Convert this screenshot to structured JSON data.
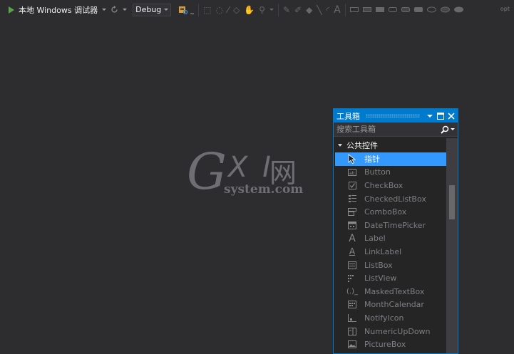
{
  "toolbar": {
    "run_label": "本地 Windows 调试器",
    "config_value": "Debug",
    "overflow_label": "opt"
  },
  "watermark": {
    "letter_g": "G",
    "letters_xi": "X I",
    "char_wang": "网",
    "subtitle": "system.com"
  },
  "toolbox": {
    "title": "工具箱",
    "search_placeholder": "搜索工具箱",
    "group_label": "公共控件",
    "items": [
      {
        "label": "指针",
        "icon": "pointer-icon",
        "selected": true
      },
      {
        "label": "Button",
        "icon": "button-icon"
      },
      {
        "label": "CheckBox",
        "icon": "checkbox-icon"
      },
      {
        "label": "CheckedListBox",
        "icon": "checkedlistbox-icon"
      },
      {
        "label": "ComboBox",
        "icon": "combobox-icon"
      },
      {
        "label": "DateTimePicker",
        "icon": "datetimepicker-icon"
      },
      {
        "label": "Label",
        "icon": "label-icon"
      },
      {
        "label": "LinkLabel",
        "icon": "linklabel-icon"
      },
      {
        "label": "ListBox",
        "icon": "listbox-icon"
      },
      {
        "label": "ListView",
        "icon": "listview-icon"
      },
      {
        "label": "MaskedTextBox",
        "icon": "maskedtextbox-icon"
      },
      {
        "label": "MonthCalendar",
        "icon": "monthcalendar-icon"
      },
      {
        "label": "NotifyIcon",
        "icon": "notifyicon-icon"
      },
      {
        "label": "NumericUpDown",
        "icon": "numericupdown-icon"
      },
      {
        "label": "PictureBox",
        "icon": "picturebox-icon"
      }
    ]
  },
  "colors": {
    "accent": "#007acc",
    "selection": "#3399ff",
    "background": "#2d2d30",
    "run_green": "#57a64a"
  }
}
